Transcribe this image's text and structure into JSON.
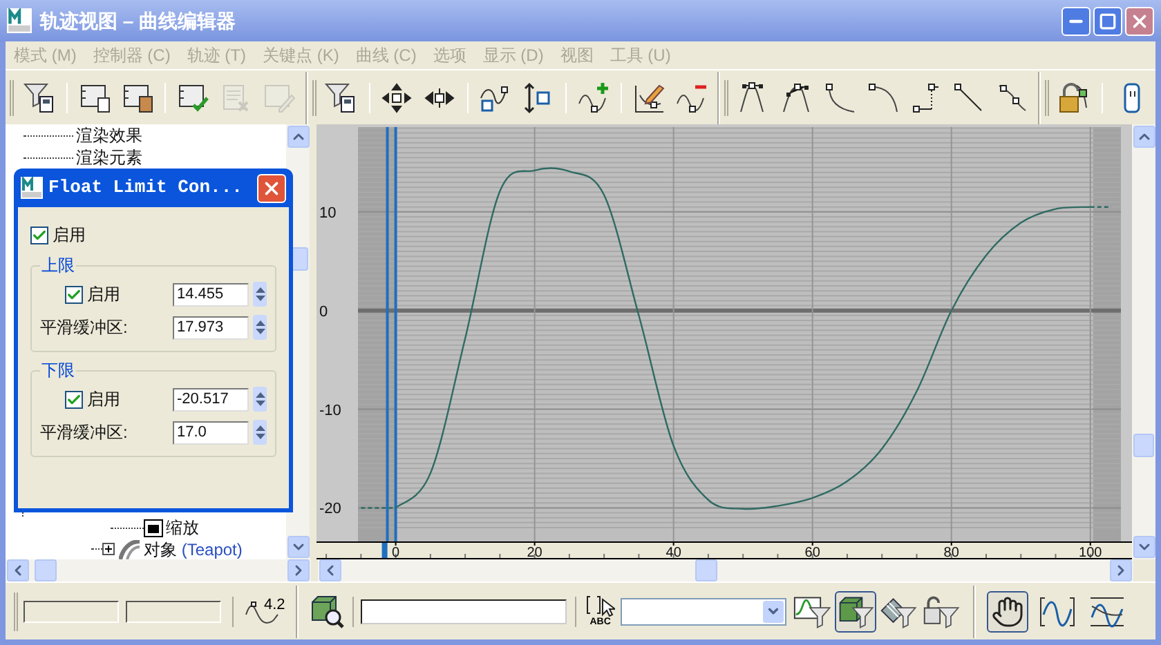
{
  "window": {
    "title": "轨迹视图 – 曲线编辑器"
  },
  "menu": [
    {
      "label": "模式 (M)",
      "disabled": true
    },
    {
      "label": "控制器 (C)",
      "disabled": true
    },
    {
      "label": "轨迹 (T)",
      "disabled": true
    },
    {
      "label": "关键点 (K)",
      "disabled": true
    },
    {
      "label": "曲线 (C)",
      "disabled": true
    },
    {
      "label": "选项",
      "disabled": true
    },
    {
      "label": "显示 (D)",
      "disabled": true
    },
    {
      "label": "视图",
      "disabled": true
    },
    {
      "label": "工具 (U)",
      "disabled": true
    }
  ],
  "toolbar": [
    {
      "kind": "handle"
    },
    {
      "kind": "filter",
      "disabled": false
    },
    {
      "kind": "separator"
    },
    {
      "kind": "copy",
      "disabled": false
    },
    {
      "kind": "paste",
      "disabled": false
    },
    {
      "kind": "separator"
    },
    {
      "kind": "assign",
      "disabled": false
    },
    {
      "kind": "delete_notes",
      "disabled": true
    },
    {
      "kind": "edit_notes",
      "disabled": true
    },
    {
      "kind": "break"
    },
    {
      "kind": "filter",
      "disabled": false
    },
    {
      "kind": "separator"
    },
    {
      "kind": "move",
      "disabled": false
    },
    {
      "kind": "slide",
      "disabled": false
    },
    {
      "kind": "separator"
    },
    {
      "kind": "scale_keys",
      "disabled": false
    },
    {
      "kind": "scale_values",
      "disabled": false
    },
    {
      "kind": "separator"
    },
    {
      "kind": "add_key",
      "disabled": false
    },
    {
      "kind": "separator"
    },
    {
      "kind": "draw",
      "disabled": false
    },
    {
      "kind": "reduce",
      "disabled": false
    },
    {
      "kind": "break"
    },
    {
      "kind": "tan_auto",
      "disabled": false
    },
    {
      "kind": "tan_custom",
      "disabled": false
    },
    {
      "kind": "tan_fast",
      "disabled": false
    },
    {
      "kind": "tan_slow",
      "disabled": false
    },
    {
      "kind": "tan_step",
      "disabled": false
    },
    {
      "kind": "tan_linear",
      "disabled": false
    },
    {
      "kind": "tan_smooth",
      "disabled": false
    },
    {
      "kind": "break"
    },
    {
      "kind": "lock",
      "disabled": false
    },
    {
      "kind": "separator"
    },
    {
      "kind": "partial",
      "disabled": false
    }
  ],
  "tree": {
    "items": [
      {
        "kind": "plain",
        "label": "渲染效果"
      },
      {
        "kind": "plain",
        "label": "渲染元素"
      },
      {
        "kind": "scale",
        "label": "缩放"
      },
      {
        "kind": "object",
        "label": "对象",
        "detail": "(Teapot)",
        "expanded": false
      }
    ]
  },
  "dialog": {
    "title": "Float Limit Con...",
    "enable": {
      "label": "启用",
      "checked": true
    },
    "groups": [
      {
        "title": "上限",
        "enable": {
          "label": "启用",
          "checked": true
        },
        "value": "14.455",
        "smooth_label": "平滑缓冲区:",
        "smooth_value": "17.973"
      },
      {
        "title": "下限",
        "enable": {
          "label": "启用",
          "checked": true
        },
        "value": "-20.517",
        "smooth_label": "平滑缓冲区:",
        "smooth_value": "17.0"
      }
    ]
  },
  "graph": {
    "chart_data": {
      "type": "line",
      "x": [
        -5,
        0,
        5,
        10,
        15,
        20,
        25,
        30,
        35,
        40,
        45,
        50,
        55,
        60,
        65,
        70,
        75,
        80,
        85,
        90,
        95,
        100,
        103
      ],
      "series": [
        {
          "color": "#2f6b62",
          "values": [
            null,
            -20,
            -16.5,
            -2.8,
            12.1,
            14.2,
            14.1,
            11.7,
            -0.5,
            -13.7,
            -19.2,
            -20.1,
            -19.8,
            -19,
            -17.3,
            -14,
            -8.2,
            0,
            5.6,
            8.9,
            10.3,
            10.5,
            null
          ]
        },
        {
          "color": "#2f6b62",
          "line_style": "dashed",
          "values": [
            -20,
            -20,
            null,
            null,
            null,
            null,
            null,
            null,
            null,
            null,
            null,
            null,
            null,
            null,
            null,
            null,
            null,
            null,
            null,
            null,
            null,
            10.5,
            10.5
          ]
        }
      ],
      "ref_lines": [
        {
          "axis": "x",
          "value": -1.2,
          "color": "#1f6fc0"
        },
        {
          "axis": "x",
          "value": 0,
          "color": "#1f6fc0"
        }
      ],
      "xlim": [
        -11.4,
        104.4
      ],
      "ylim": [
        -23.4,
        18.6
      ],
      "grid": true,
      "xticks": [
        0,
        20,
        40,
        60,
        80,
        100
      ],
      "yticks": [
        -20,
        -10,
        0,
        10
      ]
    }
  },
  "status": {
    "readout": "4.2",
    "name_select_label": "ABC",
    "filters": [
      {
        "kind": "curve",
        "selected": false
      },
      {
        "kind": "object",
        "selected": true
      },
      {
        "kind": "film",
        "selected": false
      },
      {
        "kind": "lock",
        "selected": false
      }
    ],
    "nav": [
      {
        "kind": "pan",
        "selected": true
      },
      {
        "kind": "zoom_h",
        "selected": false
      },
      {
        "kind": "zoom_ext",
        "selected": false
      }
    ]
  }
}
